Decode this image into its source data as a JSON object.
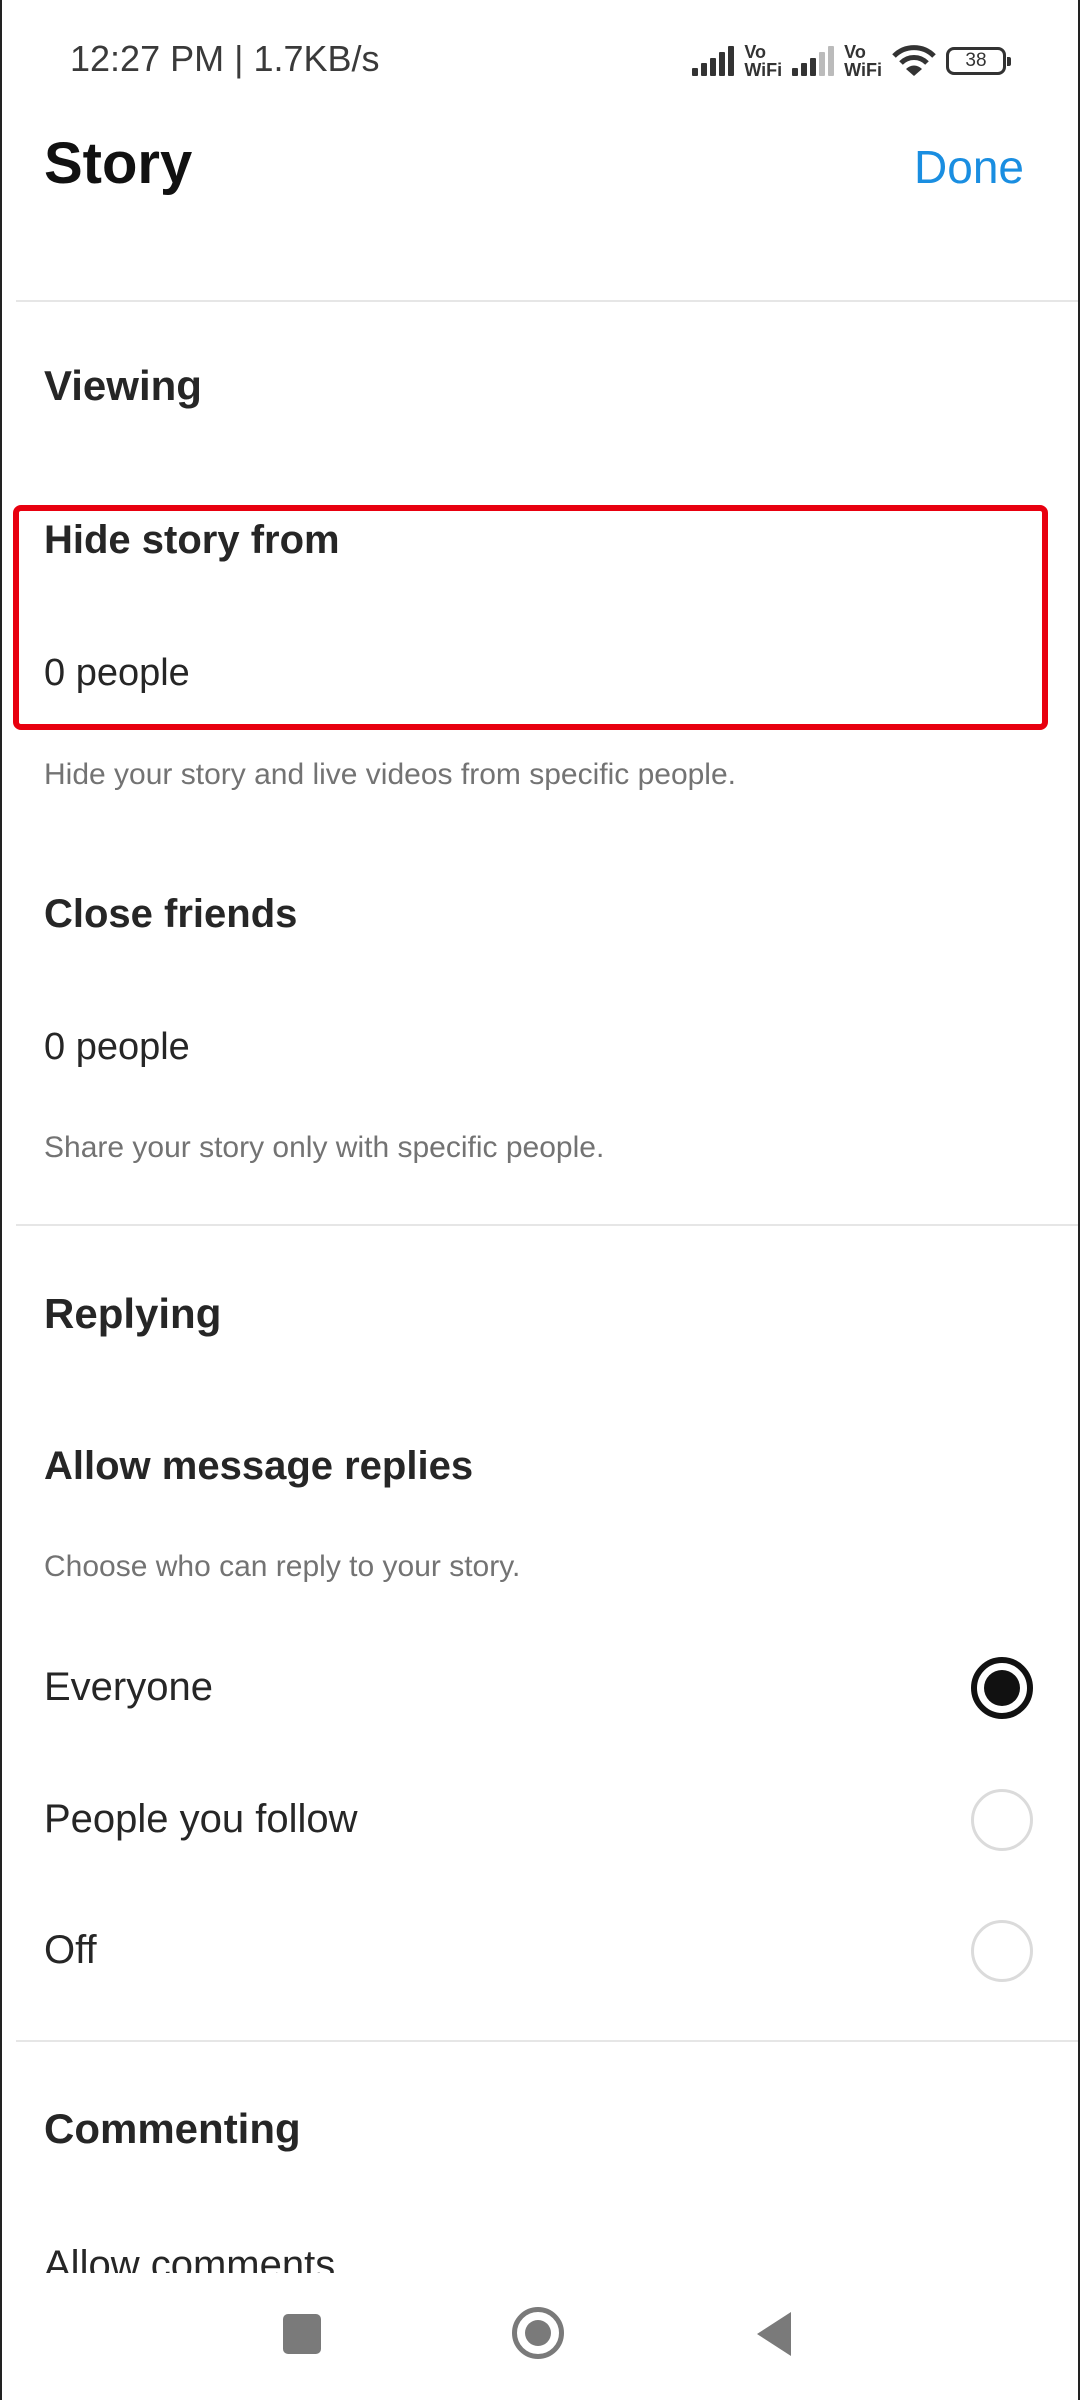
{
  "status_bar": {
    "time_speed": "12:27 PM | 1.7KB/s",
    "sim1_label_top": "Vo",
    "sim1_label_bottom": "WiFi",
    "sim2_label_top": "Vo",
    "sim2_label_bottom": "WiFi",
    "battery_level": "38"
  },
  "header": {
    "title": "Story",
    "done_label": "Done",
    "done_color": "#1a8ee1"
  },
  "viewing": {
    "section_title": "Viewing",
    "hide_story": {
      "label": "Hide story from",
      "value": "0 people",
      "description": "Hide your story and live videos from specific people.",
      "highlight_color": "#e8000f"
    },
    "close_friends": {
      "label": "Close friends",
      "value": "0 people",
      "description": "Share your story only with specific people."
    }
  },
  "replying": {
    "section_title": "Replying",
    "allow_replies_label": "Allow message replies",
    "allow_replies_description": "Choose who can reply to your story.",
    "options": [
      {
        "label": "Everyone",
        "selected": true
      },
      {
        "label": "People you follow",
        "selected": false
      },
      {
        "label": "Off",
        "selected": false
      }
    ]
  },
  "commenting": {
    "section_title": "Commenting",
    "allow_comments_label": "Allow comments"
  },
  "nav_bar": {
    "recents": "recents-icon",
    "home": "home-icon",
    "back": "back-icon"
  }
}
